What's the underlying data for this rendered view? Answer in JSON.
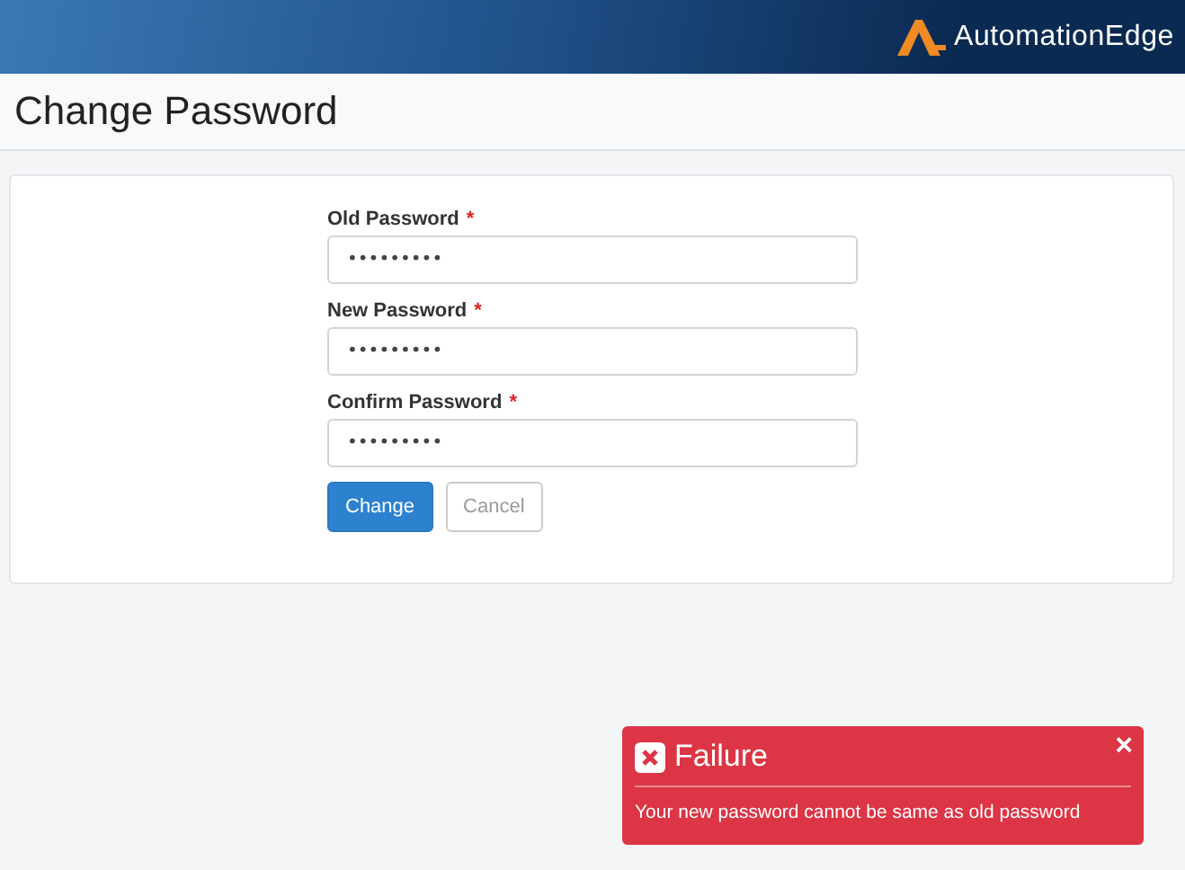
{
  "header": {
    "logo_text": "AutomationEdge"
  },
  "page_title": "Change Password",
  "form": {
    "fields": [
      {
        "label": "Old Password",
        "required_mark": "*",
        "value": "•••••••••"
      },
      {
        "label": "New Password",
        "required_mark": "*",
        "value": "•••••••••"
      },
      {
        "label": "Confirm Password",
        "required_mark": "*",
        "value": "•••••••••"
      }
    ],
    "buttons": [
      {
        "label": "Change",
        "kind": "primary"
      },
      {
        "label": "Cancel",
        "kind": "default"
      }
    ]
  },
  "toast": {
    "title": "Failure",
    "close": "×",
    "message": "Your new password cannot be same as old password"
  }
}
